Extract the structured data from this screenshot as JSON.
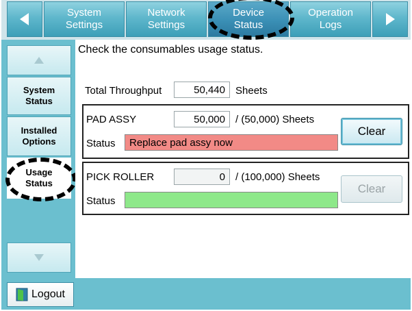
{
  "tabs": [
    {
      "label_line1": "System",
      "label_line2": "Settings"
    },
    {
      "label_line1": "Network",
      "label_line2": "Settings"
    },
    {
      "label_line1": "Device",
      "label_line2": "Status"
    },
    {
      "label_line1": "Operation",
      "label_line2": "Logs"
    }
  ],
  "sidebar": {
    "items": [
      {
        "line1": "System",
        "line2": "Status"
      },
      {
        "line1": "Installed",
        "line2": "Options"
      },
      {
        "line1": "Usage",
        "line2": "Status"
      }
    ]
  },
  "footer": {
    "logout_label": "Logout"
  },
  "main": {
    "instruction": "Check the consumables usage status.",
    "total": {
      "label": "Total Throughput",
      "value": "50,440",
      "unit": "Sheets"
    },
    "pad": {
      "name": "PAD ASSY",
      "value": "50,000",
      "limit": "/ (50,000) Sheets",
      "status_label": "Status",
      "status_text": "Replace pad assy now",
      "status_color": "#f28a86",
      "clear_label": "Clear"
    },
    "roller": {
      "name": "PICK ROLLER",
      "value": "0",
      "limit": "/ (100,000) Sheets",
      "status_label": "Status",
      "status_text": "",
      "status_color": "#8ee88a",
      "clear_label": "Clear"
    }
  }
}
